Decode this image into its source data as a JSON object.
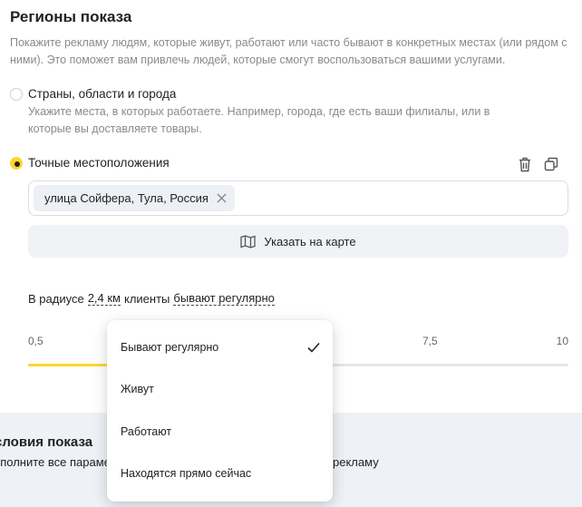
{
  "section": {
    "title": "Регионы показа",
    "description": "Покажите рекламу людям, которые живут, работают или часто бывают в конкретных местах (или рядом с ними). Это поможет вам привлечь людей, которые смогут воспользоваться вашими услугами."
  },
  "options": {
    "regions": {
      "label": "Страны, области и города",
      "hint": "Укажите места, в которых работаете. Например, города, где есть ваши филиалы, или в которые вы доставляете товары.",
      "selected": false
    },
    "exact": {
      "label": "Точные местоположения",
      "selected": true
    }
  },
  "icons": {
    "delete": "trash-icon",
    "copy": "copy-icon",
    "chip_remove": "close-icon",
    "map": "map-icon",
    "check": "checkmark-icon"
  },
  "locations": [
    {
      "label": "улица Сойфера, Тула, Россия"
    }
  ],
  "map_button": {
    "label": "Указать на карте"
  },
  "radius": {
    "prefix": "В радиусе",
    "value": "2,4 км",
    "middle": "клиенты",
    "mode": "бывают регулярно"
  },
  "slider": {
    "min_label": "0,5",
    "visible_tick": "7,5",
    "max_label": "10",
    "value": 2.4
  },
  "dropdown": {
    "items": [
      {
        "label": "Бывают регулярно",
        "selected": true
      },
      {
        "label": "Живут",
        "selected": false
      },
      {
        "label": "Работают",
        "selected": false
      },
      {
        "label": "Находятся прямо сейчас",
        "selected": false
      }
    ]
  },
  "bottom": {
    "title": "словия показа",
    "text_left": "ополните все параме",
    "text_right": "рекламу"
  },
  "colors": {
    "accent": "#fed630",
    "chip_bg": "#edf0f5",
    "button_bg": "#f0f2f5",
    "hint_text": "#8a8a8a",
    "section_bg": "#eef1f5"
  }
}
